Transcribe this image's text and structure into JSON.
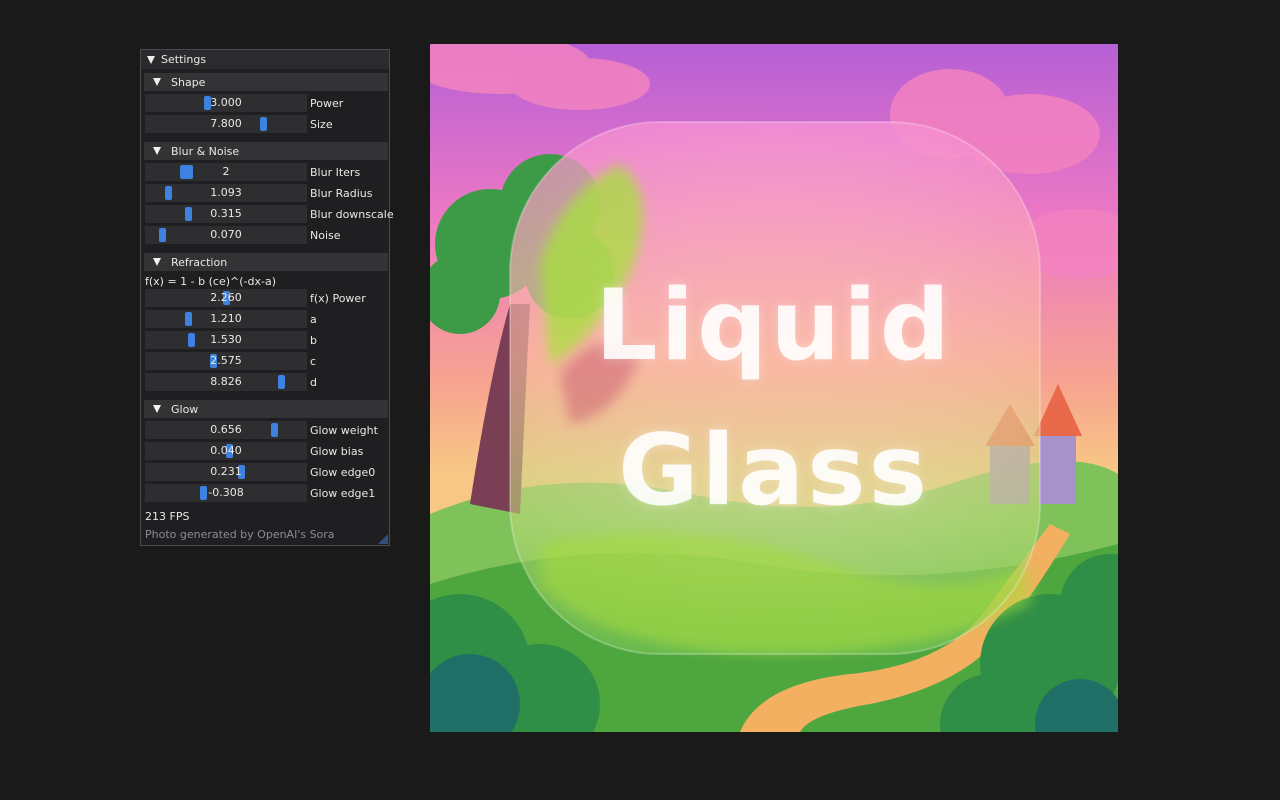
{
  "panel": {
    "title": "Settings",
    "sections": {
      "shape": {
        "label": "Shape",
        "sliders": [
          {
            "value": "3.000",
            "label": "Power",
            "fraction": 0.38
          },
          {
            "value": "7.800",
            "label": "Size",
            "fraction": 0.75
          }
        ]
      },
      "blur": {
        "label": "Blur & Noise",
        "sliders": [
          {
            "value": "2",
            "label": "Blur Iters",
            "fraction": 0.23
          },
          {
            "value": "1.093",
            "label": "Blur Radius",
            "fraction": 0.12
          },
          {
            "value": "0.315",
            "label": "Blur downscale",
            "fraction": 0.25
          },
          {
            "value": "0.070",
            "label": "Noise",
            "fraction": 0.08
          }
        ]
      },
      "refraction": {
        "label": "Refraction",
        "formula": "f(x) = 1 - b (ce)^(-dx-a)",
        "sliders": [
          {
            "value": "2.260",
            "label": "f(x) Power",
            "fraction": 0.5
          },
          {
            "value": "1.210",
            "label": "a",
            "fraction": 0.25
          },
          {
            "value": "1.530",
            "label": "b",
            "fraction": 0.27
          },
          {
            "value": "2.575",
            "label": "c",
            "fraction": 0.42
          },
          {
            "value": "8.826",
            "label": "d",
            "fraction": 0.87
          }
        ]
      },
      "glow": {
        "label": "Glow",
        "sliders": [
          {
            "value": "0.656",
            "label": "Glow weight",
            "fraction": 0.82
          },
          {
            "value": "0.040",
            "label": "Glow bias",
            "fraction": 0.52
          },
          {
            "value": "0.231",
            "label": "Glow edge0",
            "fraction": 0.6
          },
          {
            "value": "-0.308",
            "label": "Glow edge1",
            "fraction": 0.35
          }
        ]
      }
    },
    "fps": "213 FPS",
    "credit": "Photo generated by OpenAI's Sora"
  },
  "canvas": {
    "line1": "Liquid",
    "line2": "Glass"
  },
  "colors": {
    "accent": "#3d82e0",
    "panel_bg": "#1f1f21",
    "slider_bg": "#2e2e31",
    "header_bg": "#333336",
    "page_bg": "#1a1a1a"
  }
}
